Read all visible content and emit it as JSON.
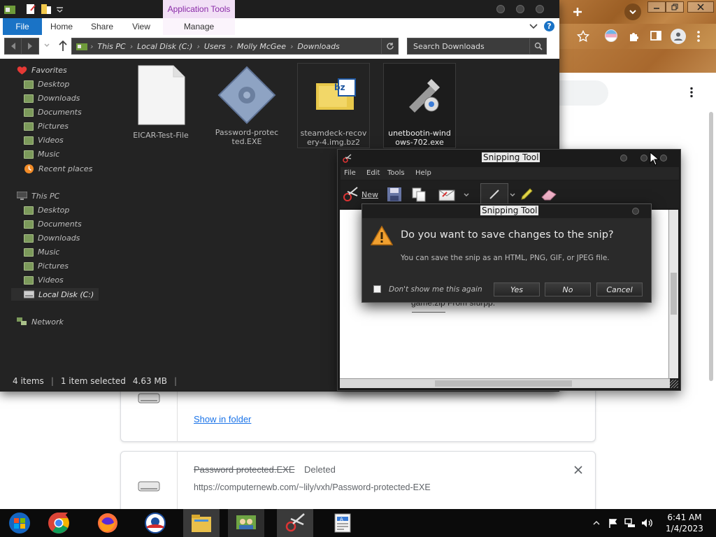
{
  "explorer": {
    "ribbon": {
      "context_tab": "Application Tools",
      "tabs": [
        "File",
        "Home",
        "Share",
        "View",
        "Manage"
      ]
    },
    "address": {
      "segments": [
        "This PC",
        "Local Disk (C:)",
        "Users",
        "Molly McGee",
        "Downloads"
      ],
      "search_placeholder": "Search Downloads"
    },
    "nav": {
      "favorites_header": "Favorites",
      "favorites": [
        "Desktop",
        "Downloads",
        "Documents",
        "Pictures",
        "Videos",
        "Music",
        "Recent places"
      ],
      "thispc_header": "This PC",
      "thispc": [
        "Desktop",
        "Documents",
        "Downloads",
        "Music",
        "Pictures",
        "Videos",
        "Local Disk (C:)"
      ],
      "network_header": "Network"
    },
    "files": [
      {
        "name": "EICAR-Test-File"
      },
      {
        "name": "Password-protected.EXE",
        "line1": "Password-protec",
        "line2": "ted.EXE"
      },
      {
        "name": "steamdeck-recovery-4.img.bz2",
        "line1": "steamdeck-recov",
        "line2": "ery-4.img.bz2",
        "badge": "bz"
      },
      {
        "name": "unetbootin-windows-702.exe",
        "line1": "unetbootin-wind",
        "line2": "ows-702.exe"
      }
    ],
    "status": {
      "items": "4 items",
      "selected": "1 item selected",
      "size": "4.63 MB"
    }
  },
  "snipping_tool": {
    "title": "Snipping Tool",
    "menu": [
      "File",
      "Edit",
      "Tools",
      "Help"
    ],
    "new_label": "New",
    "behind_text": "game.zip  From sfurpp."
  },
  "dialog": {
    "title": "Snipping Tool",
    "question": "Do you want to save changes to the snip?",
    "detail": "You can save the snip as an HTML, PNG, GIF, or JPEG file.",
    "checkbox_label": "Don't show me this again",
    "yes": "Yes",
    "no": "No",
    "cancel": "Cancel"
  },
  "chrome": {
    "downloads": {
      "show_in_folder": "Show in folder",
      "item_name": "Password protected.EXE",
      "item_status": "Deleted",
      "item_url": "https://computernewb.com/~lily/vxh/Password-protected-EXE"
    }
  },
  "taskbar": {
    "time": "6:41 AM",
    "date": "1/4/2023"
  },
  "colors": {
    "explorer_bg": "#232323",
    "ribbon_file_tab": "#1a73c6",
    "context_tab_bg": "#f2e0f6",
    "link_blue": "#1a73e8",
    "warning_orange": "#f0a030"
  }
}
